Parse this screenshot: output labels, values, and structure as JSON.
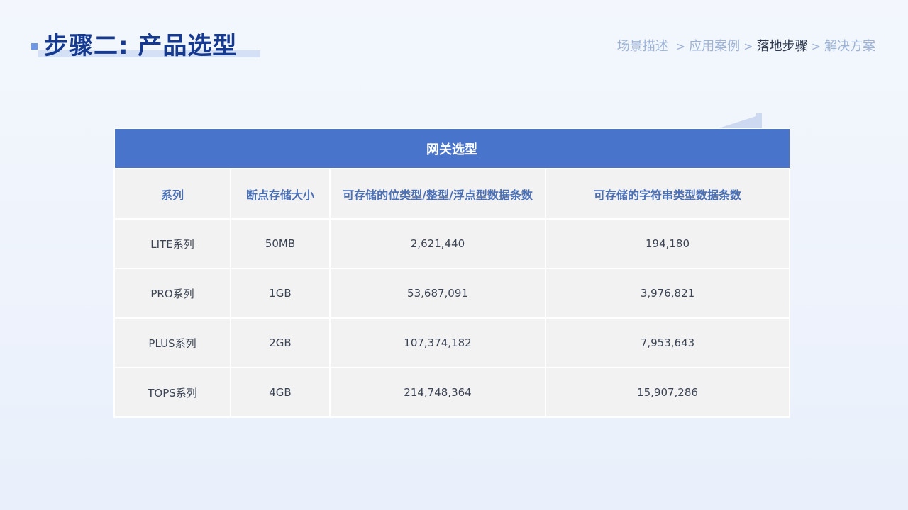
{
  "header": {
    "title": "步骤二: 产品选型"
  },
  "breadcrumb": {
    "items": [
      "场景描述",
      "应用案例",
      "落地步骤",
      "解决方案"
    ],
    "separator": ">",
    "active_index": 2
  },
  "table": {
    "caption": "网关选型",
    "headers": [
      "系列",
      "断点存储大小",
      "可存储的位类型/整型/浮点型数据条数",
      "可存储的字符串类型数据条数"
    ],
    "rows": [
      [
        "LITE系列",
        "50MB",
        "2,621,440",
        "194,180"
      ],
      [
        "PRO系列",
        "1GB",
        "53,687,091",
        "3,976,821"
      ],
      [
        "PLUS系列",
        "2GB",
        "107,374,182",
        "7,953,643"
      ],
      [
        "TOPS系列",
        "4GB",
        "214,748,364",
        "15,907,286"
      ]
    ]
  },
  "colors": {
    "title": "#163a8f",
    "accent": "#4874cc",
    "header_text": "#4a6fb4",
    "breadcrumb": "#9db3d6",
    "breadcrumb_active": "#2f3b52",
    "cell_bg": "#f2f2f2"
  }
}
